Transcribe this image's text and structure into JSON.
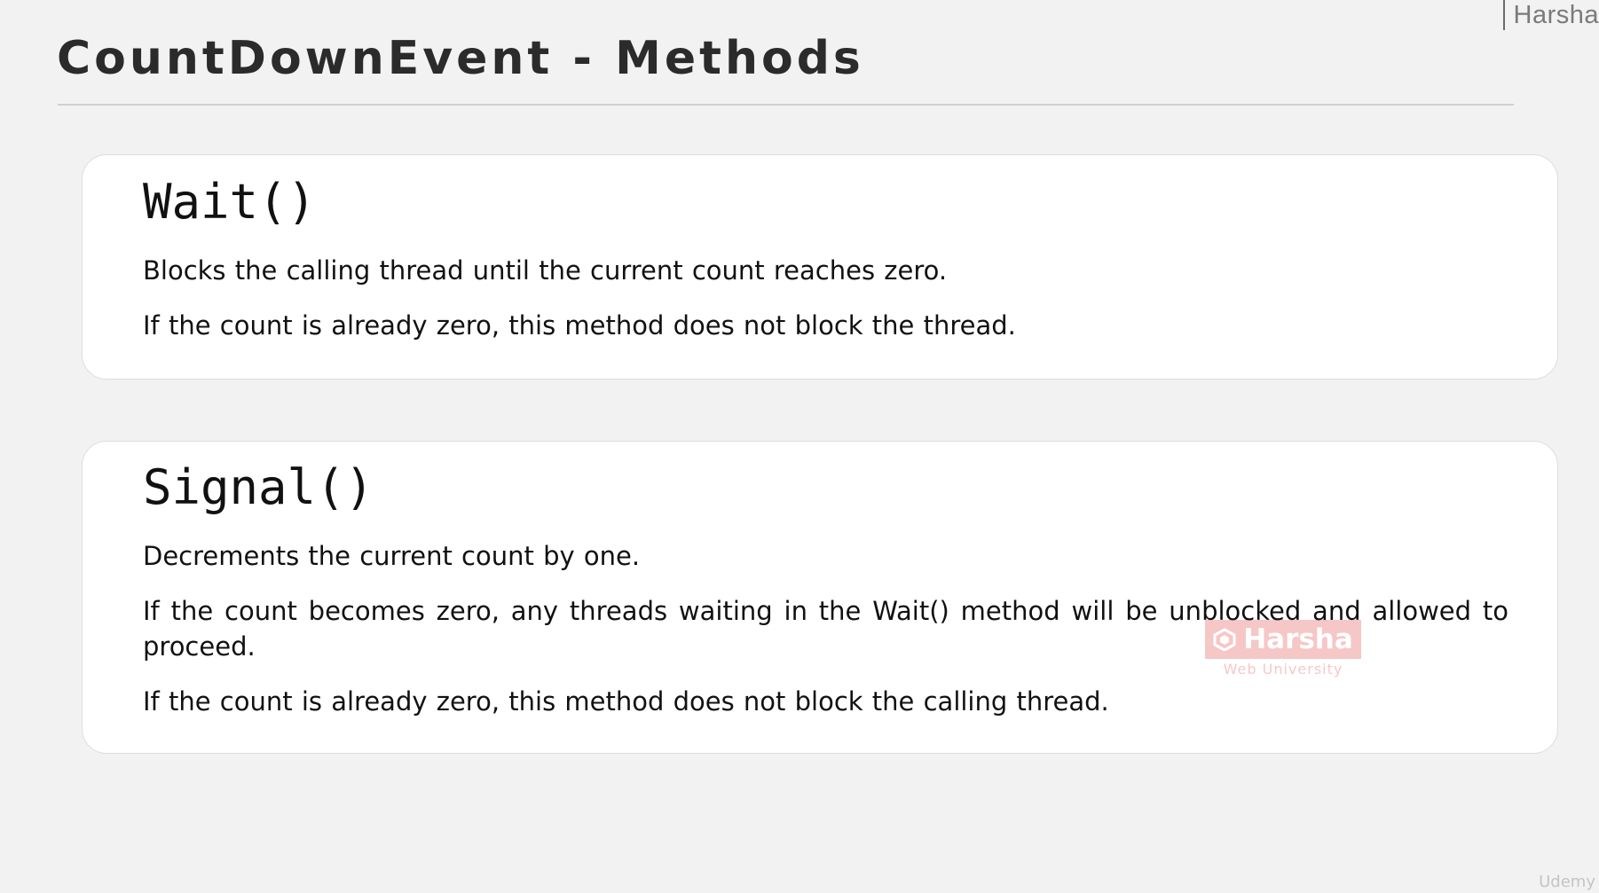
{
  "brand": {
    "top_right": "Harsha"
  },
  "slide": {
    "title": "CountDownEvent - Methods"
  },
  "methods": [
    {
      "name": "Wait()",
      "descriptions": [
        "Blocks the calling thread until the current count reaches zero.",
        "If the count is already zero, this method does not block the thread."
      ]
    },
    {
      "name": "Signal()",
      "descriptions": [
        "Decrements the current count by one.",
        "If the count becomes zero, any threads waiting in the Wait() method will be unblocked and allowed to proceed.",
        "If the count is already zero, this method does not block the calling thread."
      ]
    }
  ],
  "watermark": {
    "title": "Harsha",
    "subtitle": "Web University",
    "color": "#e23a3a"
  },
  "footer": {
    "platform": "Udemy"
  }
}
